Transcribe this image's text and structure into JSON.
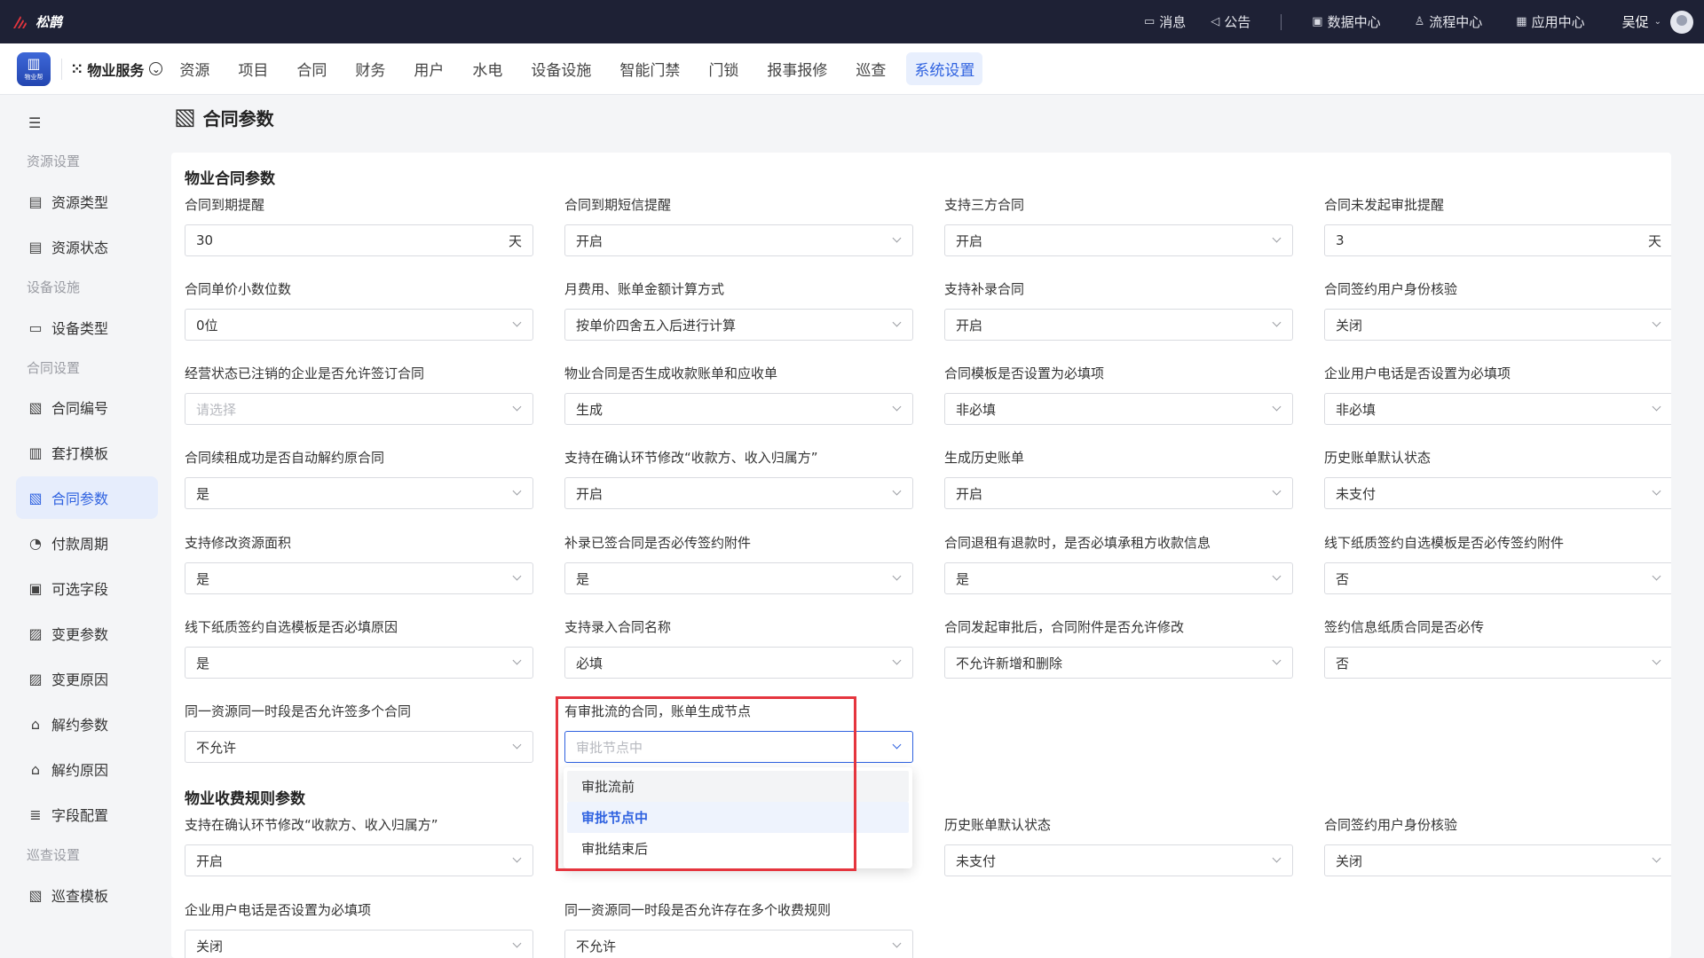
{
  "brand": {
    "name": "松鹊",
    "accent": "#e5353e"
  },
  "topnav": {
    "items": [
      {
        "label": "消息",
        "icon": "message-icon"
      },
      {
        "label": "公告",
        "icon": "megaphone-icon"
      },
      {
        "label": "数据中心",
        "icon": "data-center-icon"
      },
      {
        "label": "流程中心",
        "icon": "workflow-icon"
      },
      {
        "label": "应用中心",
        "icon": "app-grid-icon"
      }
    ],
    "user": "吴促"
  },
  "appbar": {
    "app_icon_label": "物业帮",
    "app_name": "物业服务",
    "tabs": [
      "资源",
      "项目",
      "合同",
      "财务",
      "用户",
      "水电",
      "设备设施",
      "智能门禁",
      "门锁",
      "报事报修",
      "巡查",
      "系统设置"
    ],
    "active_tab": "系统设置"
  },
  "sidebar": {
    "groups": {
      "resource": "资源设置",
      "device": "设备设施",
      "contract": "合同设置",
      "patrol": "巡查设置"
    },
    "items": [
      "资源类型",
      "资源状态",
      "设备类型",
      "合同编号",
      "套打模板",
      "合同参数",
      "付款周期",
      "可选字段",
      "变更参数",
      "变更原因",
      "解约参数",
      "解约原因",
      "字段配置",
      "巡查模板"
    ],
    "active": "合同参数"
  },
  "page": {
    "title": "合同参数"
  },
  "section1": {
    "title": "物业合同参数",
    "fields": [
      {
        "label": "合同到期提醒",
        "value": "30",
        "unit": "天"
      },
      {
        "label": "合同到期短信提醒",
        "value": "开启"
      },
      {
        "label": "支持三方合同",
        "value": "开启"
      },
      {
        "label": "合同未发起审批提醒",
        "value": "3",
        "unit": "天"
      },
      {
        "label": "合同单价小数位数",
        "value": "0位"
      },
      {
        "label": "月费用、账单金额计算方式",
        "value": "按单价四舍五入后进行计算"
      },
      {
        "label": "支持补录合同",
        "value": "开启"
      },
      {
        "label": "合同签约用户身份核验",
        "value": "关闭"
      },
      {
        "label": "经营状态已注销的企业是否允许签订合同",
        "placeholder": "请选择"
      },
      {
        "label": "物业合同是否生成收款账单和应收单",
        "value": "生成"
      },
      {
        "label": "合同模板是否设置为必填项",
        "value": "非必填"
      },
      {
        "label": "企业用户电话是否设置为必填项",
        "value": "非必填"
      },
      {
        "label": "合同续租成功是否自动解约原合同",
        "value": "是"
      },
      {
        "label": "支持在确认环节修改“收款方、收入归属方”",
        "value": "开启"
      },
      {
        "label": "生成历史账单",
        "value": "开启"
      },
      {
        "label": "历史账单默认状态",
        "value": "未支付"
      },
      {
        "label": "支持修改资源面积",
        "value": "是"
      },
      {
        "label": "补录已签合同是否必传签约附件",
        "value": "是"
      },
      {
        "label": "合同退租有退款时，是否必填承租方收款信息",
        "value": "是"
      },
      {
        "label": "线下纸质签约自选模板是否必传签约附件",
        "value": "否"
      },
      {
        "label": "线下纸质签约自选模板是否必填原因",
        "value": "是"
      },
      {
        "label": "支持录入合同名称",
        "value": "必填"
      },
      {
        "label": "合同发起审批后，合同附件是否允许修改",
        "value": "不允许新增和删除"
      },
      {
        "label": "签约信息纸质合同是否必传",
        "value": "否"
      },
      {
        "label": "同一资源同一时段是否允许签多个合同",
        "value": "不允许"
      },
      {
        "label": "有审批流的合同，账单生成节点",
        "placeholder": "审批节点中"
      }
    ]
  },
  "section2": {
    "title": "物业收费规则参数",
    "fields": [
      {
        "label": "支持在确认环节修改“收款方、收入归属方”",
        "value": "开启"
      },
      {
        "label": "历史账单默认状态",
        "value": "未支付"
      },
      {
        "label": "合同签约用户身份核验",
        "value": "关闭"
      },
      {
        "label": "企业用户电话是否设置为必填项",
        "value": "关闭"
      },
      {
        "label": "同一资源同一时段是否允许存在多个收费规则",
        "value": "不允许"
      }
    ]
  },
  "dropdown": {
    "options": [
      "审批流前",
      "审批节点中",
      "审批结束后"
    ],
    "selected": "审批节点中"
  }
}
